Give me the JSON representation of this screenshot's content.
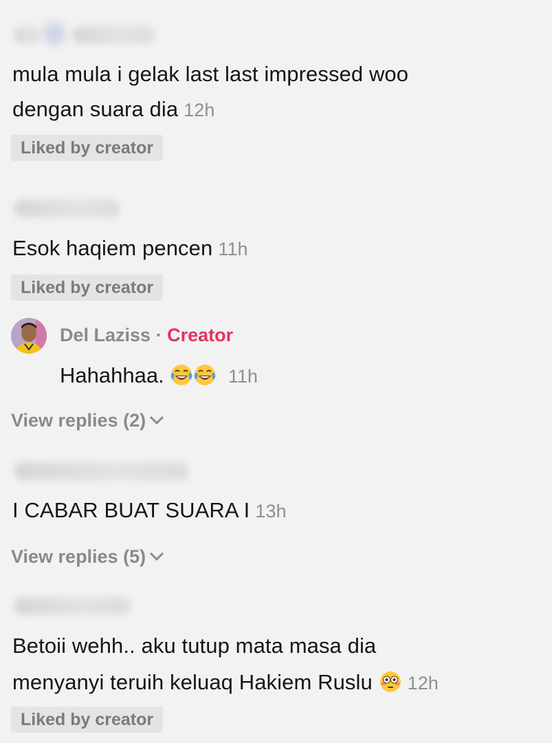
{
  "comments": [
    {
      "text_line1": "mula mula i gelak last last impressed woo",
      "text_line2": "dengan suara dia",
      "time": "12h",
      "badge": "Liked by creator"
    },
    {
      "text": "Esok haqiem pencen",
      "time": "11h",
      "badge": "Liked by creator"
    },
    {
      "text": "I CABAR BUAT SUARA I",
      "time": "13h",
      "view_replies": "View replies (5)"
    },
    {
      "text_line1": "Betoii wehh.. aku tutup mata masa dia",
      "text_line2": "menyanyi teruih keluaq Hakiem Ruslu",
      "time": "12h",
      "badge": "Liked by creator"
    }
  ],
  "creator_reply": {
    "name": "Del Laziss",
    "separator": "·",
    "role": "Creator",
    "text": "Hahahhaa.",
    "time": "11h",
    "view_replies": "View replies (2)"
  },
  "colors": {
    "creator_accent": "#e0335f",
    "muted": "#8f8f8f",
    "badge_bg": "#e4e4e4"
  },
  "icons": [
    "tears-of-joy-emoji",
    "flushed-face-emoji",
    "chevron-down-icon"
  ]
}
